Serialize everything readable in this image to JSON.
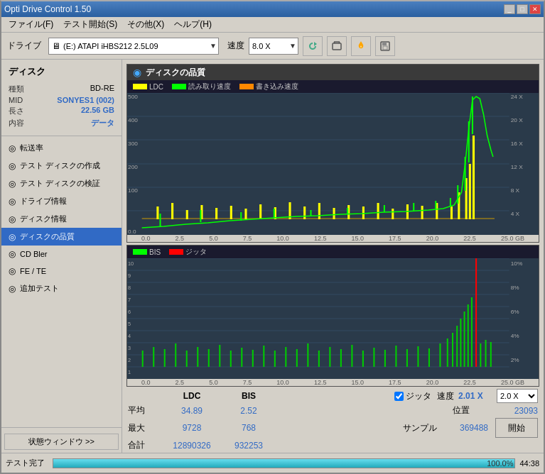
{
  "window": {
    "title": "Opti Drive Control 1.50",
    "titlebar_buttons": [
      "_",
      "□",
      "✕"
    ]
  },
  "menu": {
    "items": [
      "ファイル(F)",
      "テスト開始(S)",
      "その他(X)",
      "ヘルプ(H)"
    ]
  },
  "toolbar": {
    "drive_label": "ドライブ",
    "drive_value": "(E:)  ATAPI iHBS212  2.5L09",
    "speed_label": "速度",
    "speed_value": "8.0 X"
  },
  "sidebar": {
    "disk_section_title": "ディスク",
    "disk_info": [
      {
        "label": "種類",
        "value": "BD-RE",
        "color": "black"
      },
      {
        "label": "MID",
        "value": "SONYES1 (002)",
        "color": "blue"
      },
      {
        "label": "長さ",
        "value": "22.56 GB",
        "color": "blue"
      },
      {
        "label": "内容",
        "value": "データ",
        "color": "blue"
      }
    ],
    "nav_items": [
      {
        "label": "転送率",
        "icon": "◎",
        "active": false
      },
      {
        "label": "テスト ディスクの作成",
        "icon": "◎",
        "active": false
      },
      {
        "label": "テスト ディスクの検証",
        "icon": "◎",
        "active": false
      },
      {
        "label": "ドライブ情報",
        "icon": "◎",
        "active": false
      },
      {
        "label": "ディスク情報",
        "icon": "◎",
        "active": false
      },
      {
        "label": "ディスクの品質",
        "icon": "◎",
        "active": true
      },
      {
        "label": "CD Bler",
        "icon": "◎",
        "active": false
      },
      {
        "label": "FE / TE",
        "icon": "◎",
        "active": false
      },
      {
        "label": "追加テスト",
        "icon": "◎",
        "active": false
      }
    ],
    "status_btn": "状態ウィンドウ >>"
  },
  "chart_panel": {
    "title": "ディスクの品質",
    "legend_top": [
      {
        "label": "LDC",
        "color": "#ffff00"
      },
      {
        "label": "読み取り速度",
        "color": "#00ff00"
      },
      {
        "label": "書き込み速度",
        "color": "#ff8800"
      }
    ],
    "legend_bottom": [
      {
        "label": "BIS",
        "color": "#00ff00"
      },
      {
        "label": "ジッタ",
        "color": "#ff0000"
      }
    ],
    "top_y_axis": [
      "24 X",
      "20 X",
      "16 X",
      "12 X",
      "8 X",
      "4 X",
      ""
    ],
    "top_y_left": [
      "500",
      "400",
      "300",
      "200",
      "100",
      "0.0"
    ],
    "bottom_y_axis": [
      "10%",
      "8%",
      "6%",
      "4%",
      "2%",
      ""
    ],
    "bottom_y_left": [
      "10",
      "9",
      "8",
      "7",
      "6",
      "5",
      "4",
      "3",
      "2",
      "1"
    ],
    "x_axis": [
      "0.0",
      "2.5",
      "5.0",
      "7.5",
      "10.0",
      "12.5",
      "15.0",
      "17.5",
      "20.0",
      "22.5",
      "25.0 GB"
    ]
  },
  "stats": {
    "headers": [
      "LDC",
      "BIS"
    ],
    "avg_label": "平均",
    "avg_ldc": "34.89",
    "avg_bis": "2.52",
    "max_label": "最大",
    "max_ldc": "9728",
    "max_bis": "768",
    "total_label": "合計",
    "total_ldc": "12890326",
    "total_bis": "932253",
    "jitter_label": "ジッタ",
    "jitter_checked": true,
    "speed_label": "速度",
    "speed_value": "2.01 X",
    "speed_select": "2.0 X",
    "position_label": "位置",
    "position_value": "23093",
    "sample_label": "サンプル",
    "sample_value": "369488",
    "start_btn": "開始"
  },
  "statusbar": {
    "text": "テスト完了",
    "progress": 100,
    "progress_pct": "100.0%",
    "time": "44:38"
  }
}
